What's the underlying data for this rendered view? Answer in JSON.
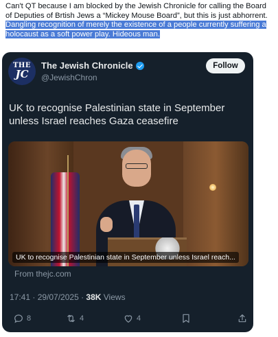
{
  "post": {
    "text_plain": "Can't QT because I am blocked by the Jewish Chronicle for calling the Board of Deputies of Brtish Jews a “Mickey Mouse Board”, but this is just abhorrent. ",
    "text_highlighted": "Dangling recognition of merely the existence of a people currently suffering a holocaust as a soft power play. Hideous man."
  },
  "embedded_tweet": {
    "avatar_text_top": "THE",
    "avatar_text_bottom": "JC",
    "account_name": "The Jewish Chronicle",
    "handle": "@JewishChron",
    "follow_label": "Follow",
    "text": "UK to recognise Palestinian state in September unless Israel reaches Gaza ceasefire",
    "media_caption": "UK to recognise Palestinian state in September unless Israel reach...",
    "from_label": "From thejc.com",
    "timestamp": "17:41 · 29/07/2025 · ",
    "views_count": "38K",
    "views_label": " Views",
    "actions": {
      "reply_count": "8",
      "retweet_count": "4",
      "like_count": "4"
    }
  },
  "colors": {
    "card_bg": "#15202b",
    "highlight": "#4a7bd6",
    "verified": "#1d9bf0",
    "muted": "#8b98a5"
  }
}
